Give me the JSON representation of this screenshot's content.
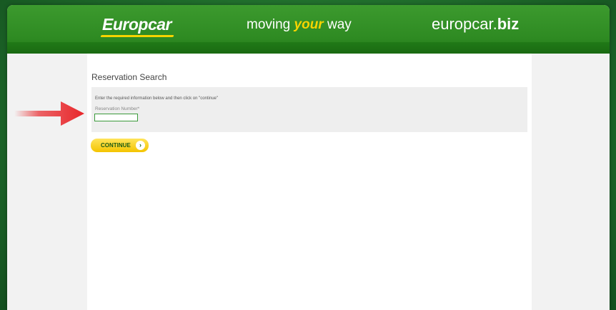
{
  "header": {
    "logo": "Europcar",
    "tagline_start": "moving ",
    "tagline_accent": "your",
    "tagline_end": " way",
    "site_name": "europcar.",
    "site_tld": "biz"
  },
  "page": {
    "title": "Reservation Search",
    "instructions": "Enter the required information below and then click on \"continue\"",
    "reservation_label": "Reservation Number*",
    "reservation_value": "",
    "continue_label": "CONTINUE",
    "continue_icon": "chevron-right-icon"
  },
  "annotation": {
    "icon": "red-arrow-icon",
    "color": "#e8262a"
  },
  "colors": {
    "brand_green": "#2e8a22",
    "brand_yellow": "#f7d400"
  }
}
